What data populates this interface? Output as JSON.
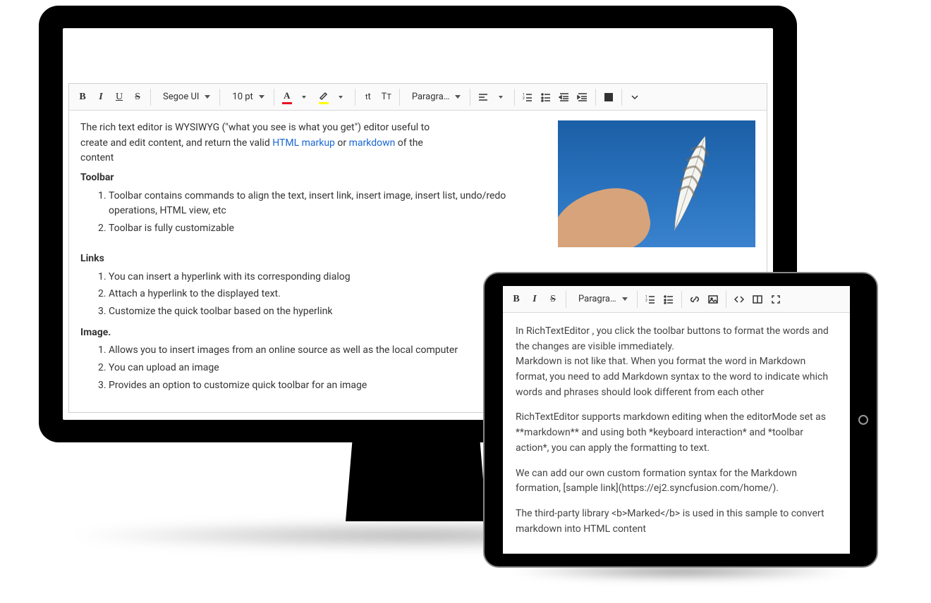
{
  "monitor": {
    "toolbar": {
      "font_family": "Segoe UI",
      "font_size": "10 pt",
      "format": "Paragra…"
    },
    "content": {
      "intro_pre": "The rich text editor is WYSIWYG (\"what you see is what you get\") editor useful to create and edit content, and return the valid ",
      "link1": "HTML markup",
      "intro_mid": " or ",
      "link2": "markdown",
      "intro_post": " of the content",
      "sec_toolbar": "Toolbar",
      "toolbar_items": [
        "Toolbar contains commands to align the text, insert link, insert image, insert list, undo/redo operations, HTML view, etc",
        "Toolbar is fully customizable"
      ],
      "sec_links": "Links",
      "links_items": [
        "You can insert a hyperlink with its corresponding dialog",
        "Attach a hyperlink to the displayed text.",
        "Customize the quick toolbar based on the hyperlink"
      ],
      "sec_image": "Image.",
      "image_items": [
        "Allows you to insert images from an online source as well as the local computer",
        "You can upload an image",
        "Provides an option to customize quick toolbar for an image"
      ]
    }
  },
  "tablet": {
    "toolbar": {
      "format": "Paragra…"
    },
    "content": {
      "p1": "In RichTextEditor , you click the toolbar buttons to format the words and the changes are visible immediately.",
      "p1b": "Markdown is not like that. When you format the word in Markdown format, you need to add Markdown syntax to the word to indicate which words and phrases should look different from each other",
      "p2": "RichTextEditor supports markdown editing when the editorMode set as **markdown** and using both *keyboard interaction* and *toolbar action*, you can apply the formatting to text.",
      "p3": "We can add our own custom formation syntax for the Markdown formation, [sample link](https://ej2.syncfusion.com/home/).",
      "p4": "The third-party library <b>Marked</b> is used in this sample to convert markdown into HTML content"
    }
  }
}
